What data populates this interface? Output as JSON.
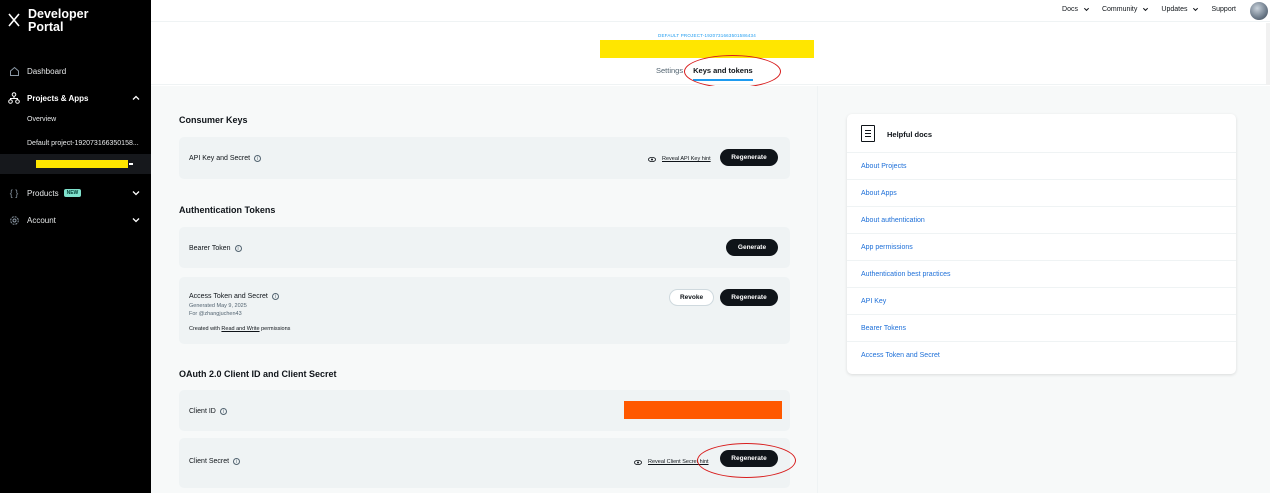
{
  "sidebar": {
    "brand": "Developer Portal",
    "nav": {
      "dashboard": "Dashboard",
      "projects_apps": "Projects & Apps",
      "overview": "Overview",
      "default_project": "Default project-192073166350158...",
      "products": "Products",
      "products_badge": "NEW",
      "account": "Account"
    }
  },
  "topnav": {
    "docs": "Docs",
    "community": "Community",
    "updates": "Updates",
    "support": "Support"
  },
  "header": {
    "project_id": "DEFAULT PROJECT-1920731663501586434",
    "tabs": {
      "settings": "Settings",
      "keys_tokens": "Keys and tokens"
    }
  },
  "consumer_keys": {
    "title": "Consumer Keys",
    "api_key_label": "API Key and Secret",
    "reveal_label": "Reveal API Key hint",
    "regenerate": "Regenerate"
  },
  "auth_tokens": {
    "title": "Authentication Tokens",
    "bearer_label": "Bearer Token",
    "generate": "Generate",
    "access_label": "Access Token and Secret",
    "generated_on": "Generated May 9, 2025",
    "for_user": "For @zhangjuchen43",
    "created_prefix": "Created with",
    "permission": "Read and Write",
    "created_suffix": "permissions",
    "revoke": "Revoke",
    "regenerate": "Regenerate"
  },
  "oauth2": {
    "title": "OAuth 2.0 Client ID and Client Secret",
    "client_id_label": "Client ID",
    "client_secret_label": "Client Secret",
    "reveal_label": "Reveal Client Secret hint",
    "regenerate": "Regenerate"
  },
  "helpful_docs": {
    "title": "Helpful docs",
    "links": [
      "About Projects",
      "About Apps",
      "About authentication",
      "App permissions",
      "Authentication best practices",
      "API Key",
      "Bearer Tokens",
      "Access Token and Secret"
    ]
  },
  "colors": {
    "accent": "#1d9bf0",
    "link": "#1d6fd8",
    "annotation": "#d81e1e",
    "redaction_yellow": "#ffe600",
    "redaction_orange": "#ff5900"
  }
}
